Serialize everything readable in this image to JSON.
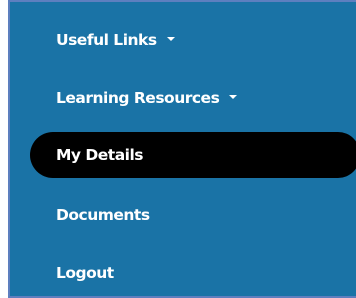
{
  "colors": {
    "nav_background": "#1a73a6",
    "nav_border": "#5d7fbf",
    "active_background": "#000000",
    "text": "#ffffff"
  },
  "nav": {
    "items": [
      {
        "label": "Useful Links",
        "has_dropdown": true,
        "icon": "caret-down-icon"
      },
      {
        "label": "Learning Resources",
        "has_dropdown": true,
        "icon": "caret-down-icon"
      },
      {
        "label": "My Details",
        "active": true
      },
      {
        "label": "Documents"
      },
      {
        "label": "Logout"
      }
    ]
  }
}
